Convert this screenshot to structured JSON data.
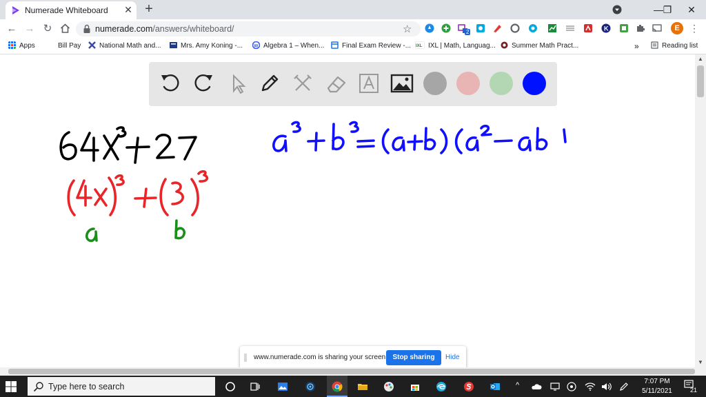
{
  "tab": {
    "title": "Numerade Whiteboard",
    "close": "✕",
    "new_tab": "+"
  },
  "window": {
    "minimize": "—",
    "restore": "❐",
    "close": "✕"
  },
  "address": {
    "domain": "numerade.com",
    "path": "/answers/whiteboard/"
  },
  "bookmarks": {
    "apps": "Apps",
    "items": [
      "Bill Pay",
      "National Math and...",
      "Mrs. Amy Koning -...",
      "Algebra 1 – When...",
      "Final Exam Review -...",
      "IXL | Math, Languag...",
      "Summer Math Pract..."
    ],
    "more": "»",
    "reading_list": "Reading list"
  },
  "profile_initial": "E",
  "ext_badge": "2",
  "whiteboard": {
    "colors": {
      "gray": "#a6a6a6",
      "pink": "#e8b4b4",
      "green": "#b3d6b3",
      "blue": "#0011ff"
    },
    "handwriting": {
      "line1": "64x³+27",
      "line2": "(4x)³+(3)³",
      "label_a": "a",
      "label_b": "b",
      "formula": "a³+b³=(a+b)(a²−ab"
    }
  },
  "sharing": {
    "message": "www.numerade.com is sharing your screen.",
    "stop": "Stop sharing",
    "hide": "Hide"
  },
  "taskbar": {
    "search_placeholder": "Type here to search",
    "time": "7:07 PM",
    "date": "5/11/2021",
    "notification_count": "21"
  }
}
